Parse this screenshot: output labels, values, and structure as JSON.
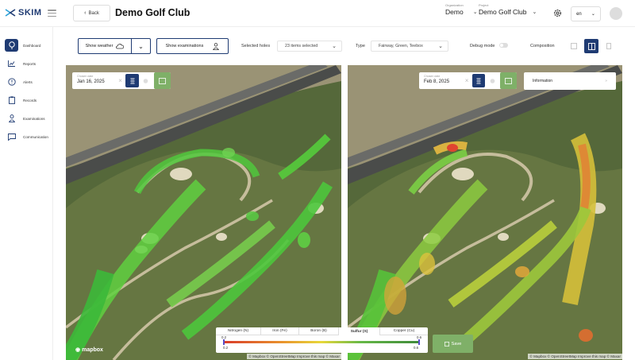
{
  "brand": {
    "name": "SKIM"
  },
  "header": {
    "back_label": "Back",
    "page_title": "Demo Golf Club",
    "organization_label": "Organization",
    "organization_value": "Demo",
    "project_label": "Project",
    "project_value": "Demo Golf Club",
    "language": "en"
  },
  "sidebar": {
    "items": [
      {
        "label": "Dashboard",
        "icon": "dashboard-icon"
      },
      {
        "label": "Reports",
        "icon": "chart-icon"
      },
      {
        "label": "Alerts",
        "icon": "alert-icon"
      },
      {
        "label": "Records",
        "icon": "clipboard-icon"
      },
      {
        "label": "Examinations",
        "icon": "person-icon"
      },
      {
        "label": "Communication",
        "icon": "chat-icon"
      }
    ]
  },
  "toolbar": {
    "show_weather": "Show weather",
    "show_examinations": "Show examinations",
    "selected_holes_label": "Selected holes",
    "selected_holes_value": "23 items selected",
    "type_label": "Type",
    "type_value": "Fairway, Green, Teebox",
    "debug_label": "Debug mode",
    "composition_label": "Composition"
  },
  "map_left": {
    "date_label": "Chosen date",
    "date_value": "Jan 16, 2025",
    "mapbox": "mapbox"
  },
  "map_right": {
    "date_label": "Chosen date",
    "date_value": "Feb 8, 2025",
    "info_label": "Information",
    "attribution": "© Mapbox © OpenStreetMap Improve this map © Maxar"
  },
  "legend": {
    "tabs": [
      "Nitrogen (N)",
      "Iron (Fe)",
      "Boron (B)",
      "Sulfur (S)",
      "Copper (Cu)"
    ],
    "active_tab": "Sulfur (S)",
    "min_top": "0.2",
    "max_top": "0.6",
    "min_bottom": "0.2",
    "max_bottom": "0.6"
  },
  "save_label": "Save",
  "colors": {
    "primary": "#1f3b73",
    "accent_green": "#7fb068"
  }
}
